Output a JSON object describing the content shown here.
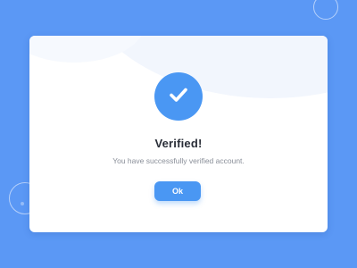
{
  "dialog": {
    "icon": "checkmark-icon",
    "title": "Verified!",
    "message": "You have successfully verified account.",
    "ok_label": "Ok"
  },
  "colors": {
    "background": "#5b98f5",
    "accent": "#4a97f3",
    "card": "#ffffff",
    "title_text": "#2a2e38",
    "message_text": "#8a8f99"
  }
}
